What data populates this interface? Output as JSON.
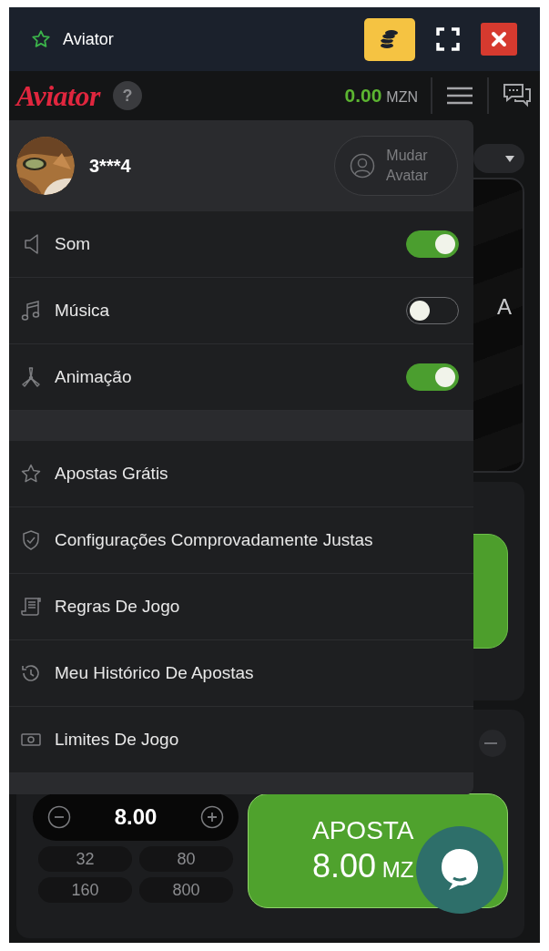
{
  "window": {
    "title": "Aviator"
  },
  "game_header": {
    "logo": "Aviator",
    "help": "?",
    "balance": "0.00",
    "currency": "MZN"
  },
  "game_behind": {
    "peek_text": "A"
  },
  "menu": {
    "profile": {
      "username": "3***4",
      "change_avatar_button": "Mudar Avatar"
    },
    "settings": [
      {
        "label": "Som",
        "on": true
      },
      {
        "label": "Música",
        "on": false
      },
      {
        "label": "Animação",
        "on": true
      }
    ],
    "links": [
      {
        "label": "Apostas Grátis"
      },
      {
        "label": "Configurações Comprovadamente Justas"
      },
      {
        "label": "Regras De Jogo"
      },
      {
        "label": "Meu Histórico De Apostas"
      },
      {
        "label": "Limites De Jogo"
      }
    ]
  },
  "bet_panel": {
    "amount": "8.00",
    "quick_amounts": [
      "32",
      "80",
      "160",
      "800"
    ],
    "bet_button": {
      "label": "APOSTA",
      "amount": "8.00",
      "currency": "MZ"
    }
  }
}
